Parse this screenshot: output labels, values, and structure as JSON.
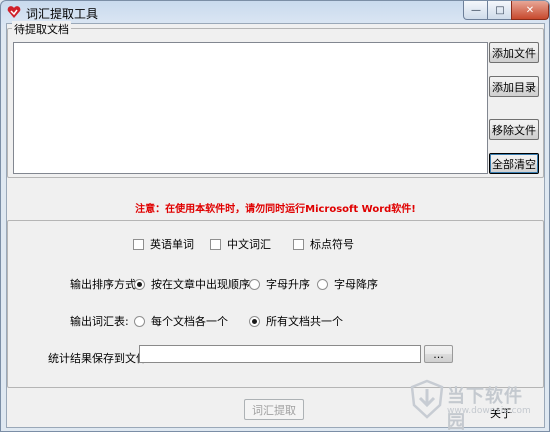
{
  "window": {
    "title": "词汇提取工具",
    "caption": {
      "minimize": "—",
      "maximize": "□",
      "close": "✕"
    }
  },
  "doc_group": {
    "label": "待提取文档"
  },
  "buttons": {
    "add_file": "添加文件",
    "add_dir": "添加目录",
    "remove_file": "移除文件",
    "clear_all": "全部清空",
    "browse": "...",
    "extract": "词汇提取",
    "exit": "关于"
  },
  "notice": "注意：在使用本软件时，请勿同时运行Microsoft Word软件!",
  "options": {
    "types": [
      {
        "label": "英语单词",
        "checked": false
      },
      {
        "label": "中文词汇",
        "checked": false
      },
      {
        "label": "标点符号",
        "checked": false
      }
    ],
    "sort_label": "输出排序方式:",
    "sort": [
      {
        "label": "按在文章中出现顺序",
        "checked": true
      },
      {
        "label": "字母升序",
        "checked": false
      },
      {
        "label": "字母降序",
        "checked": false
      }
    ],
    "vocab_label": "输出词汇表:",
    "vocab": [
      {
        "label": "每个文档各一个",
        "checked": false
      },
      {
        "label": "所有文档共一个",
        "checked": true
      }
    ],
    "save_label": "统计结果保存到文件:",
    "save_path": ""
  },
  "watermark": {
    "text": "当下软件园",
    "url_text": "www.downxia.com"
  },
  "colors": {
    "notice": "#e00000",
    "title_bar": "#c9daee",
    "close_button": "#c7492d"
  }
}
